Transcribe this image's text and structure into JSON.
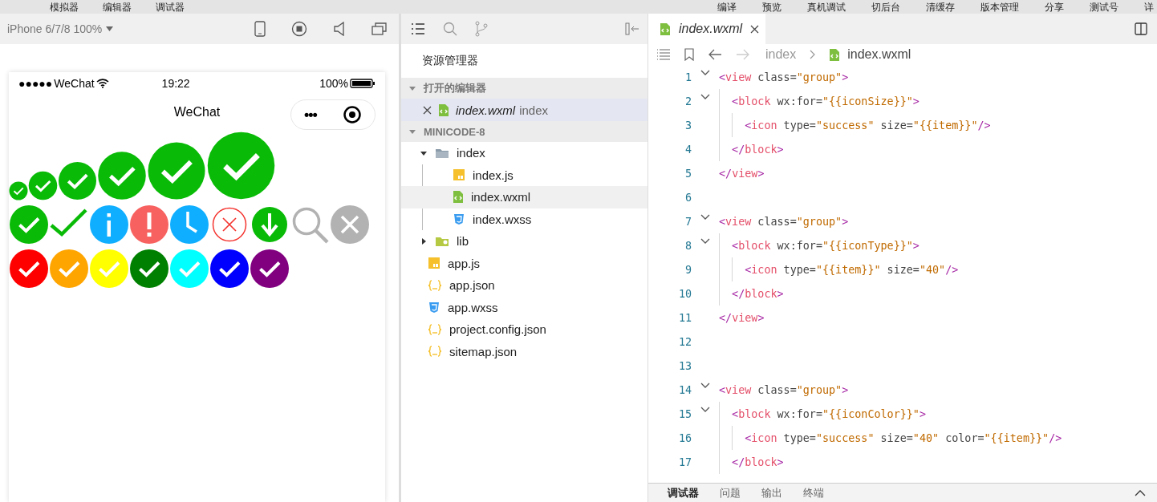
{
  "menu_bar": {
    "left": [
      "模拟器",
      "编辑器",
      "调试器"
    ],
    "right": [
      "编译",
      "预览",
      "真机调试",
      "切后台",
      "清缓存",
      "版本管理",
      "分享",
      "测试号",
      "详"
    ]
  },
  "simulator": {
    "device": "iPhone 6/7/8 100%"
  },
  "phone": {
    "signal": "●●●●●",
    "carrier": "WeChat",
    "time": "19:22",
    "battery": "100%",
    "title": "WeChat",
    "capsule_menu": "•••",
    "icon_groups": [
      {
        "kind": "sizes",
        "icons": [
          {
            "kind": "success"
          },
          {
            "kind": "success"
          },
          {
            "kind": "success"
          },
          {
            "kind": "success"
          },
          {
            "kind": "success"
          },
          {
            "kind": "success"
          }
        ]
      },
      {
        "kind": "types",
        "icons": [
          {
            "kind": "success"
          },
          {
            "kind": "success_no_circle"
          },
          {
            "kind": "info"
          },
          {
            "kind": "warn"
          },
          {
            "kind": "waiting"
          },
          {
            "kind": "cancel"
          },
          {
            "kind": "download"
          },
          {
            "kind": "search"
          },
          {
            "kind": "clear"
          }
        ]
      },
      {
        "kind": "colors",
        "icons": [
          {
            "kind": "success",
            "color": "#ff0000"
          },
          {
            "kind": "success",
            "color": "#ffa500"
          },
          {
            "kind": "success",
            "color": "#ffff00"
          },
          {
            "kind": "success",
            "color": "#008000"
          },
          {
            "kind": "success",
            "color": "#00ffff"
          },
          {
            "kind": "success",
            "color": "#0000ff"
          },
          {
            "kind": "success",
            "color": "#800080"
          }
        ]
      }
    ]
  },
  "explorer": {
    "title": "资源管理器",
    "open_editors": {
      "label": "打开的编辑器",
      "expanded": true,
      "items": [
        {
          "name": "index.wxml",
          "path": "index",
          "kind": "wxml",
          "selected": true
        }
      ]
    },
    "project": {
      "label": "MINICODE-8",
      "expanded": true,
      "items": [
        {
          "name": "index",
          "kind": "folder",
          "expanded": true,
          "selected": false,
          "children": [
            {
              "name": "index.js",
              "kind": "js",
              "selected": false
            },
            {
              "name": "index.wxml",
              "kind": "wxml",
              "selected": true
            },
            {
              "name": "index.wxss",
              "kind": "wxss",
              "selected": false
            }
          ]
        },
        {
          "name": "lib",
          "kind": "lib-folder",
          "expanded": false,
          "selected": false
        },
        {
          "name": "app.js",
          "kind": "js",
          "selected": false
        },
        {
          "name": "app.json",
          "kind": "json",
          "selected": false
        },
        {
          "name": "app.wxss",
          "kind": "wxss",
          "selected": false
        },
        {
          "name": "project.config.json",
          "kind": "json",
          "selected": false
        },
        {
          "name": "sitemap.json",
          "kind": "json",
          "selected": false
        }
      ]
    }
  },
  "editor": {
    "tabs": [
      {
        "label": "index.wxml",
        "kind": "wxml",
        "selected": true
      }
    ],
    "breadcrumb": [
      {
        "text": "index",
        "kind": "folder"
      },
      {
        "text": "index.wxml",
        "kind": "wxml"
      }
    ],
    "lines": [
      {
        "number": "1",
        "fold": true,
        "tokens": [
          {
            "text": "<",
            "kind": "punct"
          },
          {
            "text": "view",
            "kind": "tag"
          },
          {
            "text": " class=",
            "kind": "attr"
          },
          {
            "text": "\"group\"",
            "kind": "string"
          },
          {
            "text": ">",
            "kind": "punct"
          }
        ],
        "children": [
          {
            "number": "2",
            "fold": true,
            "tokens": [
              {
                "text": "<",
                "kind": "punct"
              },
              {
                "text": "block",
                "kind": "tag"
              },
              {
                "text": " wx:for=",
                "kind": "attr"
              },
              {
                "text": "\"{{iconSize}}\"",
                "kind": "string"
              },
              {
                "text": ">",
                "kind": "punct"
              }
            ],
            "children": [
              {
                "number": "3",
                "fold": false,
                "tokens": [
                  {
                    "text": "<",
                    "kind": "punct"
                  },
                  {
                    "text": "icon",
                    "kind": "tag"
                  },
                  {
                    "text": " type=",
                    "kind": "attr"
                  },
                  {
                    "text": "\"success\"",
                    "kind": "string"
                  },
                  {
                    "text": " size=",
                    "kind": "attr"
                  },
                  {
                    "text": "\"{{item}}\"",
                    "kind": "string"
                  },
                  {
                    "text": "/>",
                    "kind": "punct"
                  }
                ]
              }
            ]
          },
          {
            "number": "4",
            "fold": false,
            "tokens": [
              {
                "text": "</",
                "kind": "punct"
              },
              {
                "text": "block",
                "kind": "tag"
              },
              {
                "text": ">",
                "kind": "punct"
              }
            ]
          }
        ]
      },
      {
        "number": "5",
        "fold": false,
        "tokens": [
          {
            "text": "</",
            "kind": "punct"
          },
          {
            "text": "view",
            "kind": "tag"
          },
          {
            "text": ">",
            "kind": "punct"
          }
        ]
      },
      {
        "number": "6",
        "fold": false
      },
      {
        "number": "7",
        "fold": true,
        "tokens": [
          {
            "text": "<",
            "kind": "punct"
          },
          {
            "text": "view",
            "kind": "tag"
          },
          {
            "text": " class=",
            "kind": "attr"
          },
          {
            "text": "\"group\"",
            "kind": "string"
          },
          {
            "text": ">",
            "kind": "punct"
          }
        ],
        "children": [
          {
            "number": "8",
            "fold": true,
            "tokens": [
              {
                "text": "<",
                "kind": "punct"
              },
              {
                "text": "block",
                "kind": "tag"
              },
              {
                "text": " wx:for=",
                "kind": "attr"
              },
              {
                "text": "\"{{iconType}}\"",
                "kind": "string"
              },
              {
                "text": ">",
                "kind": "punct"
              }
            ],
            "children": [
              {
                "number": "9",
                "fold": false,
                "tokens": [
                  {
                    "text": "<",
                    "kind": "punct"
                  },
                  {
                    "text": "icon",
                    "kind": "tag"
                  },
                  {
                    "text": " type=",
                    "kind": "attr"
                  },
                  {
                    "text": "\"{{item}}\"",
                    "kind": "string"
                  },
                  {
                    "text": " size=",
                    "kind": "attr"
                  },
                  {
                    "text": "\"40\"",
                    "kind": "string"
                  },
                  {
                    "text": "/>",
                    "kind": "punct"
                  }
                ]
              }
            ]
          },
          {
            "number": "10",
            "fold": false,
            "tokens": [
              {
                "text": "</",
                "kind": "punct"
              },
              {
                "text": "block",
                "kind": "tag"
              },
              {
                "text": ">",
                "kind": "punct"
              }
            ]
          }
        ]
      },
      {
        "number": "11",
        "fold": false,
        "tokens": [
          {
            "text": "</",
            "kind": "punct"
          },
          {
            "text": "view",
            "kind": "tag"
          },
          {
            "text": ">",
            "kind": "punct"
          }
        ]
      },
      {
        "number": "12",
        "fold": false
      },
      {
        "number": "13",
        "fold": false
      },
      {
        "number": "14",
        "fold": true,
        "tokens": [
          {
            "text": "<",
            "kind": "punct"
          },
          {
            "text": "view",
            "kind": "tag"
          },
          {
            "text": " class=",
            "kind": "attr"
          },
          {
            "text": "\"group\"",
            "kind": "string"
          },
          {
            "text": ">",
            "kind": "punct"
          }
        ],
        "children": [
          {
            "number": "15",
            "fold": true,
            "tokens": [
              {
                "text": "<",
                "kind": "punct"
              },
              {
                "text": "block",
                "kind": "tag"
              },
              {
                "text": " wx:for=",
                "kind": "attr"
              },
              {
                "text": "\"{{iconColor}}\"",
                "kind": "string"
              },
              {
                "text": ">",
                "kind": "punct"
              }
            ],
            "children": [
              {
                "number": "16",
                "fold": false,
                "tokens": [
                  {
                    "text": "<",
                    "kind": "punct"
                  },
                  {
                    "text": "icon",
                    "kind": "tag"
                  },
                  {
                    "text": " type=",
                    "kind": "attr"
                  },
                  {
                    "text": "\"success\"",
                    "kind": "string"
                  },
                  {
                    "text": " size=",
                    "kind": "attr"
                  },
                  {
                    "text": "\"40\"",
                    "kind": "string"
                  },
                  {
                    "text": " color=",
                    "kind": "attr"
                  },
                  {
                    "text": "\"{{item}}\"",
                    "kind": "string"
                  },
                  {
                    "text": "/>",
                    "kind": "punct"
                  }
                ]
              }
            ]
          },
          {
            "number": "17",
            "fold": false,
            "tokens": [
              {
                "text": "</",
                "kind": "punct"
              },
              {
                "text": "block",
                "kind": "tag"
              },
              {
                "text": ">",
                "kind": "punct"
              }
            ]
          }
        ]
      }
    ]
  },
  "bottom_panel": {
    "tabs": [
      {
        "label": "调试器",
        "selected": true
      },
      {
        "label": "问题",
        "selected": false
      },
      {
        "label": "输出",
        "selected": false
      },
      {
        "label": "终端",
        "selected": false
      }
    ]
  }
}
